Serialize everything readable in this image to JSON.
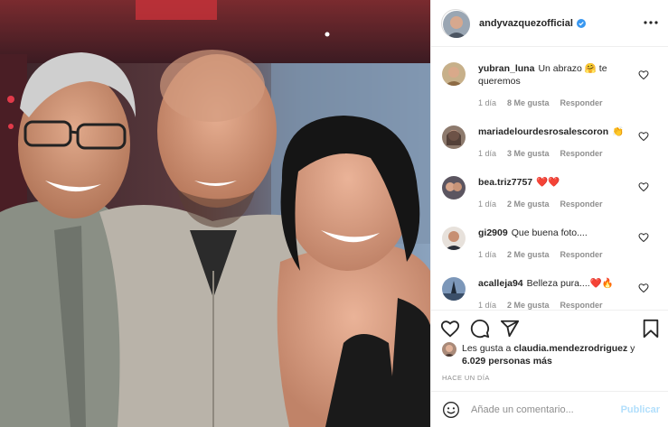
{
  "header": {
    "username": "andyvazquezofficial",
    "verified": true,
    "avatar_icon": "profile-avatar",
    "more_icon": "more-horizontal-icon"
  },
  "comments": [
    {
      "user": "yubran_luna",
      "text": "Un abrazo 🤗 te queremos",
      "age": "1 día",
      "likes": "8 Me gusta",
      "reply": "Responder"
    },
    {
      "user": "mariadelourdesrosalescoron",
      "text": "👏",
      "age": "1 día",
      "likes": "3 Me gusta",
      "reply": "Responder"
    },
    {
      "user": "bea.triz7757",
      "text": "❤️❤️",
      "age": "1 día",
      "likes": "2 Me gusta",
      "reply": "Responder"
    },
    {
      "user": "gi2909",
      "text": "Que buena foto....",
      "age": "1 día",
      "likes": "2 Me gusta",
      "reply": "Responder"
    },
    {
      "user": "acalleja94",
      "text": "Belleza pura....❤️🔥",
      "age": "1 día",
      "likes": "2 Me gusta",
      "reply": "Responder"
    }
  ],
  "actions": {
    "like_icon": "heart-icon",
    "comment_icon": "comment-icon",
    "share_icon": "share-icon",
    "save_icon": "bookmark-icon"
  },
  "likes": {
    "prefix": "Les gusta a ",
    "user": "claudia.mendezrodriguez",
    "connector": " y",
    "count": "6.029 personas más"
  },
  "timestamp": "HACE UN DÍA",
  "add_comment": {
    "placeholder": "Añade un comentario...",
    "post_label": "Publicar"
  },
  "colors": {
    "verified": "#3897f0",
    "link_disabled": "#b2dffc",
    "meta_text": "#8e8e8e",
    "heart_red": "#ed4956"
  }
}
